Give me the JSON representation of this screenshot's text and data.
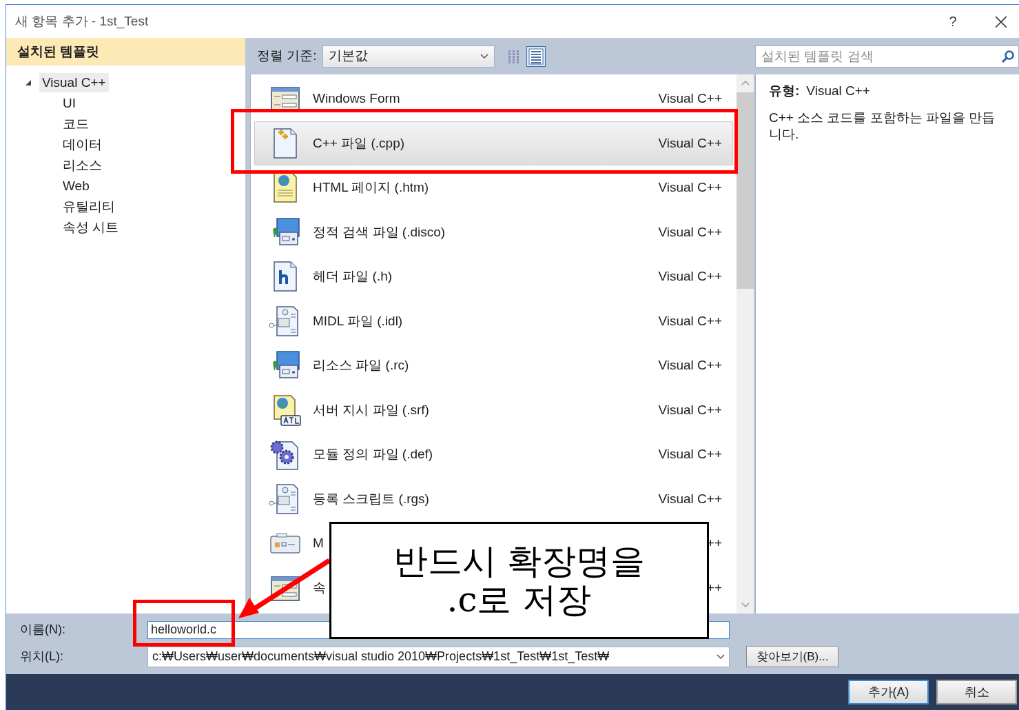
{
  "window": {
    "title": "새 항목 추가 - 1st_Test",
    "help": "?",
    "close": "×"
  },
  "sidebar": {
    "header": "설치된 템플릿",
    "tree": [
      {
        "label": "Visual C++",
        "expanded": true,
        "selected": true,
        "children": [
          {
            "label": "UI",
            "selected": false
          },
          {
            "label": "코드",
            "selected": false
          },
          {
            "label": "데이터",
            "selected": false
          },
          {
            "label": "리소스",
            "selected": false
          },
          {
            "label": "Web",
            "selected": false
          },
          {
            "label": "유틸리티",
            "selected": false
          },
          {
            "label": "속성 시트",
            "selected": false
          }
        ]
      }
    ]
  },
  "toolbar": {
    "sort_label": "정렬 기준:",
    "sort_value": "기본값",
    "view_buttons": [
      {
        "kind": "small",
        "selected": false
      },
      {
        "kind": "list",
        "selected": true
      }
    ]
  },
  "templates": [
    {
      "kind": "form",
      "name": "Windows Form",
      "type": "Visual C++",
      "selected": false
    },
    {
      "kind": "cpp",
      "name": "C++ 파일 (.cpp)",
      "type": "Visual C++",
      "selected": true
    },
    {
      "kind": "html",
      "name": "HTML 페이지 (.htm)",
      "type": "Visual C++",
      "selected": false
    },
    {
      "kind": "disco",
      "name": "정적 검색 파일 (.disco)",
      "type": "Visual C++",
      "selected": false
    },
    {
      "kind": "header",
      "name": "헤더 파일 (.h)",
      "type": "Visual C++",
      "selected": false
    },
    {
      "kind": "midl",
      "name": "MIDL 파일 (.idl)",
      "type": "Visual C++",
      "selected": false
    },
    {
      "kind": "disco",
      "name": "리소스 파일 (.rc)",
      "type": "Visual C++",
      "selected": false
    },
    {
      "kind": "srf",
      "name": "서버 지시 파일 (.srf)",
      "type": "Visual C++",
      "selected": false
    },
    {
      "kind": "def",
      "name": "모듈 정의 파일 (.def)",
      "type": "Visual C++",
      "selected": false
    },
    {
      "kind": "midl",
      "name": "등록 스크립트 (.rgs)",
      "type": "Visual C++",
      "selected": false
    },
    {
      "kind": "component",
      "name": "M",
      "type": "++",
      "selected": false
    },
    {
      "kind": "form",
      "name": "속",
      "type": "++",
      "selected": false
    }
  ],
  "search": {
    "placeholder": "설치된 템플릿 검색"
  },
  "details": {
    "type_label": "유형:",
    "type_value": "Visual C++",
    "description": "C++ 소스 코드를 포함하는 파일을 만듭니다."
  },
  "name_field": {
    "label": "이름(N):",
    "value": "helloworld.c"
  },
  "location_field": {
    "label": "위치(L):",
    "value": "c:₩Users₩user₩documents₩visual studio 2010₩Projects₩1st_Test₩1st_Test₩"
  },
  "browse_button": "찾아보기(B)...",
  "buttons": [
    {
      "label": "추가(A)",
      "kind": "default"
    },
    {
      "label": "취소",
      "kind": "normal"
    }
  ],
  "callout": {
    "lines": [
      "반드시 확장명을",
      ".c로 저장"
    ]
  }
}
